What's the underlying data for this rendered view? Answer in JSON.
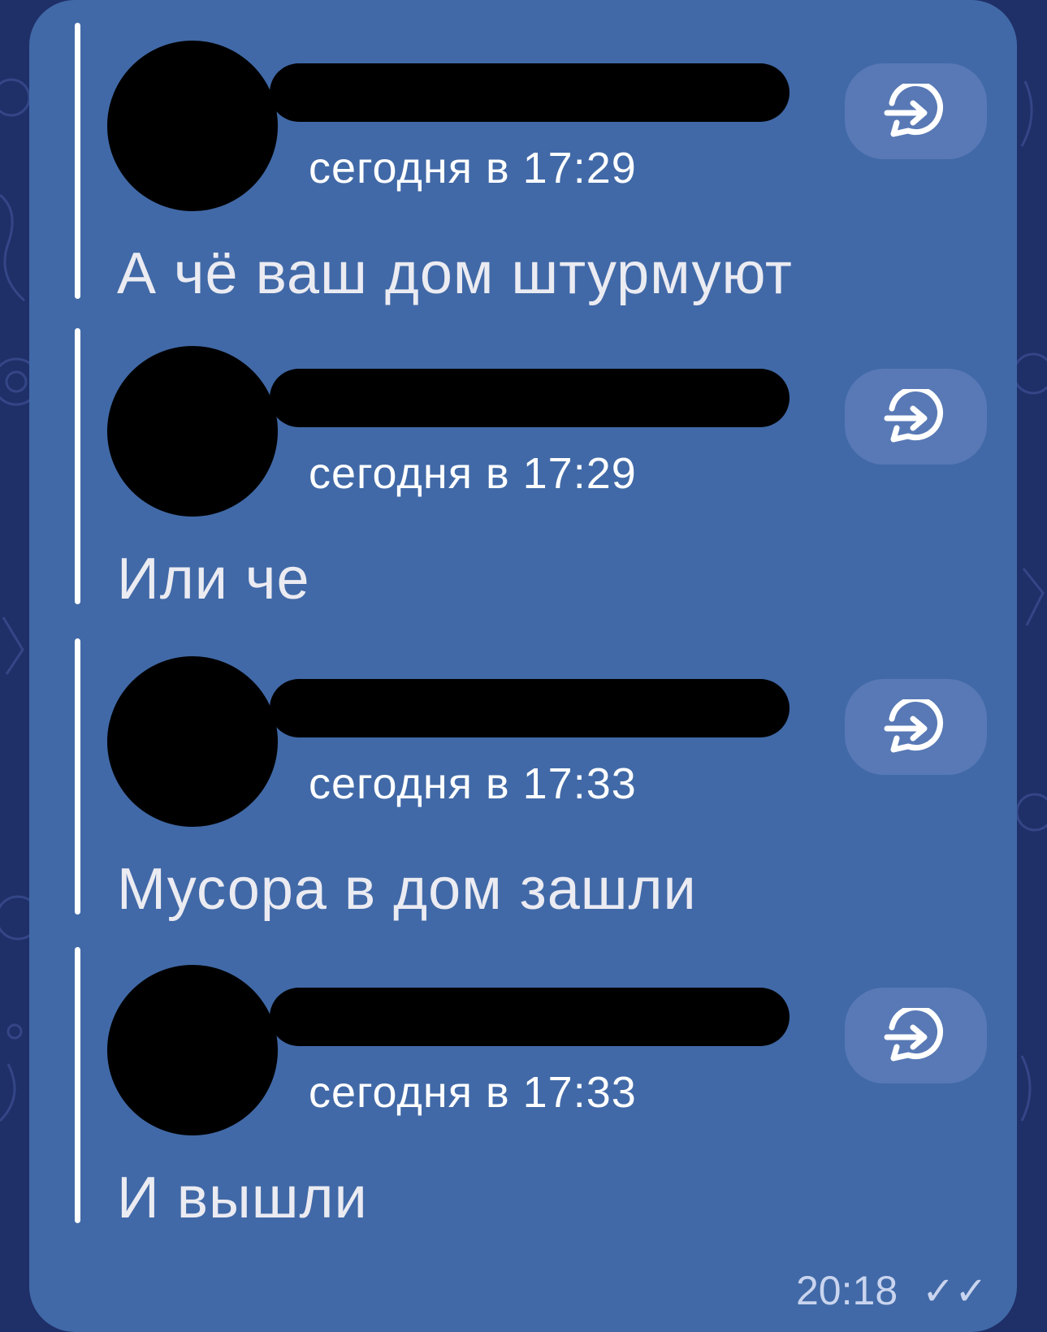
{
  "messages": [
    {
      "time": "сегодня в 17:29",
      "text": "А чё ваш дом штурмуют"
    },
    {
      "time": "сегодня в 17:29",
      "text": "Или че"
    },
    {
      "time": "сегодня в 17:33",
      "text": "Мусора в дом зашли"
    },
    {
      "time": "сегодня в 17:33",
      "text": "И вышли"
    }
  ],
  "footer": {
    "time": "20:18",
    "check_icon": "double-check-icon"
  },
  "icons": {
    "forward": "forward-reply-icon"
  },
  "colors": {
    "background": "#1f2f68",
    "bubble": "#4169a7",
    "button": "#5879b5",
    "text": "#ebebf2"
  }
}
